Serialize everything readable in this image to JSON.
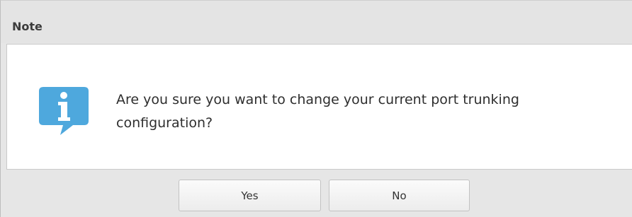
{
  "dialog": {
    "title": "Note",
    "icon": "info-icon",
    "message": "Are you sure you want to change your current port trunking configuration?",
    "buttons": {
      "yes_label": "Yes",
      "no_label": "No"
    }
  },
  "colors": {
    "icon_blue": "#4ea8dd",
    "dialog_bg": "#e6e6e6",
    "panel_bg": "#ffffff"
  }
}
